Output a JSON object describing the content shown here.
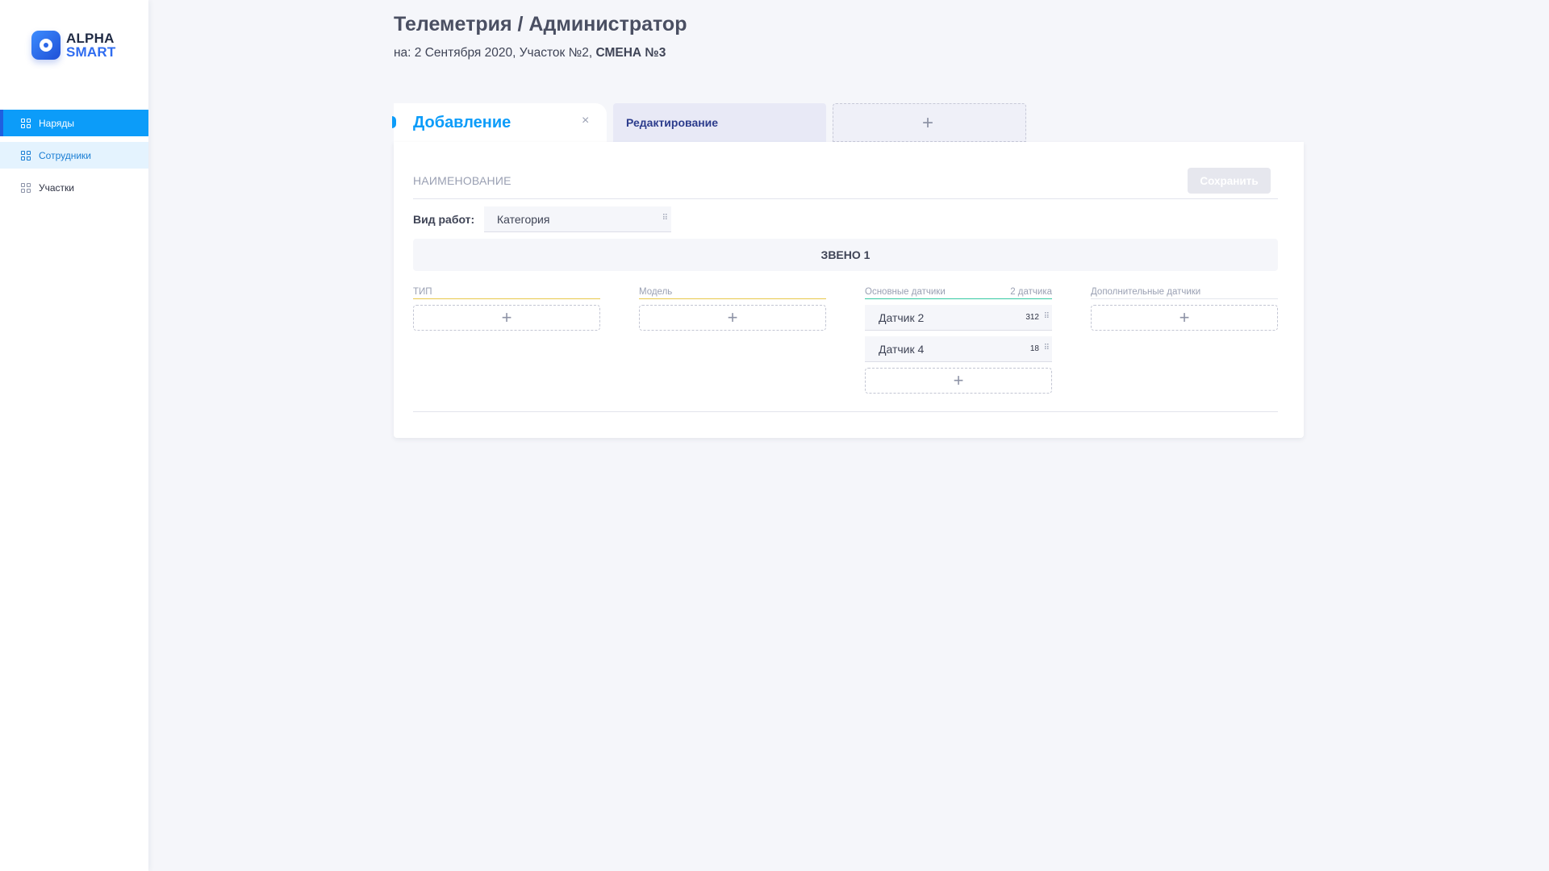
{
  "brand": {
    "line1": "ALPHA",
    "line2": "SMART"
  },
  "sidebar": {
    "items": [
      {
        "label": "Наряды",
        "state": "active"
      },
      {
        "label": "Сотрудники",
        "state": "hover"
      },
      {
        "label": "Участки",
        "state": "default"
      }
    ]
  },
  "header": {
    "title": "Телеметрия / Администратор",
    "subtitle_prefix": "на: 2 Сентября 2020,  Участок №2, ",
    "subtitle_bold": "СМЕНА №3"
  },
  "tabs": {
    "active_label": "Добавление",
    "close_symbol": "×",
    "edit_label": "Редактирование",
    "add_symbol": "+"
  },
  "form": {
    "name_placeholder": "НАИМЕНОВАНИЕ",
    "save_label": "Сохранить",
    "work_type_label": "Вид работ:",
    "work_type_value": "Категория",
    "grip_symbol": "⠿",
    "zveno_title": "ЗВЕНО 1",
    "columns": {
      "type": {
        "title": "ТИП"
      },
      "model": {
        "title": "Модель"
      },
      "main_sensors": {
        "title": "Основные датчики",
        "count": "2 датчика",
        "items": [
          {
            "name": "Датчик 2",
            "value": "312"
          },
          {
            "name": "Датчик 4",
            "value": "18"
          }
        ]
      },
      "extra_sensors": {
        "title": "Дополнительные датчики"
      }
    },
    "add_symbol": "+"
  },
  "colors": {
    "accent": "#0c9cf9",
    "brand_blue": "#2f6cf0",
    "tab_edit_bg": "#e8e9f6",
    "yellow_line": "#e8c84a",
    "teal_line": "#36c9a3"
  }
}
